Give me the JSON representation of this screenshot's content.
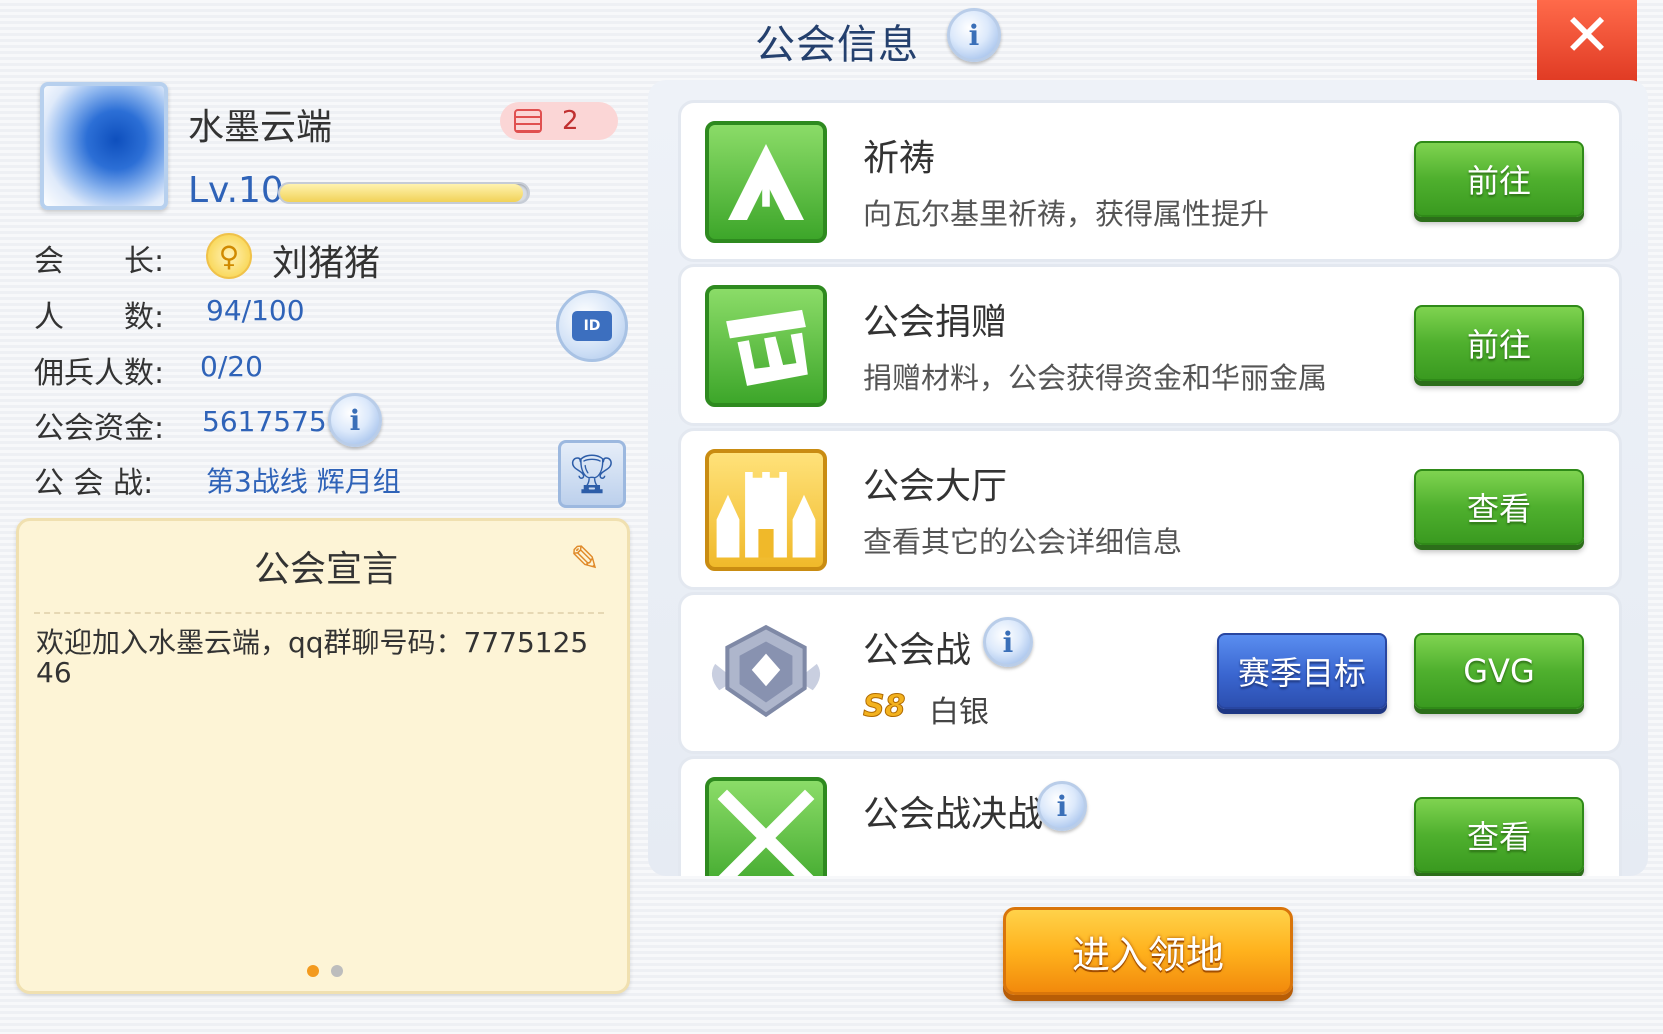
{
  "header": {
    "title": "公会信息",
    "info_icon": "i",
    "close_icon": "✕"
  },
  "guild": {
    "name": "水墨云端",
    "server": "2",
    "level": "Lv.10",
    "exp_fraction": 0.98,
    "leader_label": "会　　长:",
    "leader_name": "刘猪猪",
    "members_label": "人　　数:",
    "members": "94/100",
    "mercenary_label": "佣兵人数:",
    "mercenary": "0/20",
    "funds_label": "公会资金:",
    "funds": "56175751",
    "war_label": "公 会 战:",
    "war_value": "第3战线  辉月组",
    "id_label": "ID"
  },
  "declaration": {
    "title": "公会宣言",
    "text": "欢迎加入水墨云端，qq群聊号码：777512546"
  },
  "features": [
    {
      "title": "祈祷",
      "desc": "向瓦尔基里祈祷，获得属性提升",
      "button": "前往",
      "icon": "prayer-icon"
    },
    {
      "title": "公会捐赠",
      "desc": "捐赠材料，公会获得资金和华丽金属",
      "button": "前往",
      "icon": "donation-icon"
    },
    {
      "title": "公会大厅",
      "desc": "查看其它的公会详细信息",
      "button": "查看",
      "icon": "castle-icon"
    },
    {
      "title": "公会战",
      "season_badge": "S8",
      "rank": "白银",
      "season_button": "赛季目标",
      "button": "GVG",
      "icon": "silver-shield-icon"
    },
    {
      "title": "公会战决战",
      "button": "查看",
      "icon": "crossed-swords-icon"
    }
  ],
  "enter_button": "进入领地",
  "colors": {
    "accent_blue": "#2f63b8",
    "green_button": "#4fb02e",
    "orange_button": "#ffb21d",
    "close_red": "#d9301b"
  }
}
